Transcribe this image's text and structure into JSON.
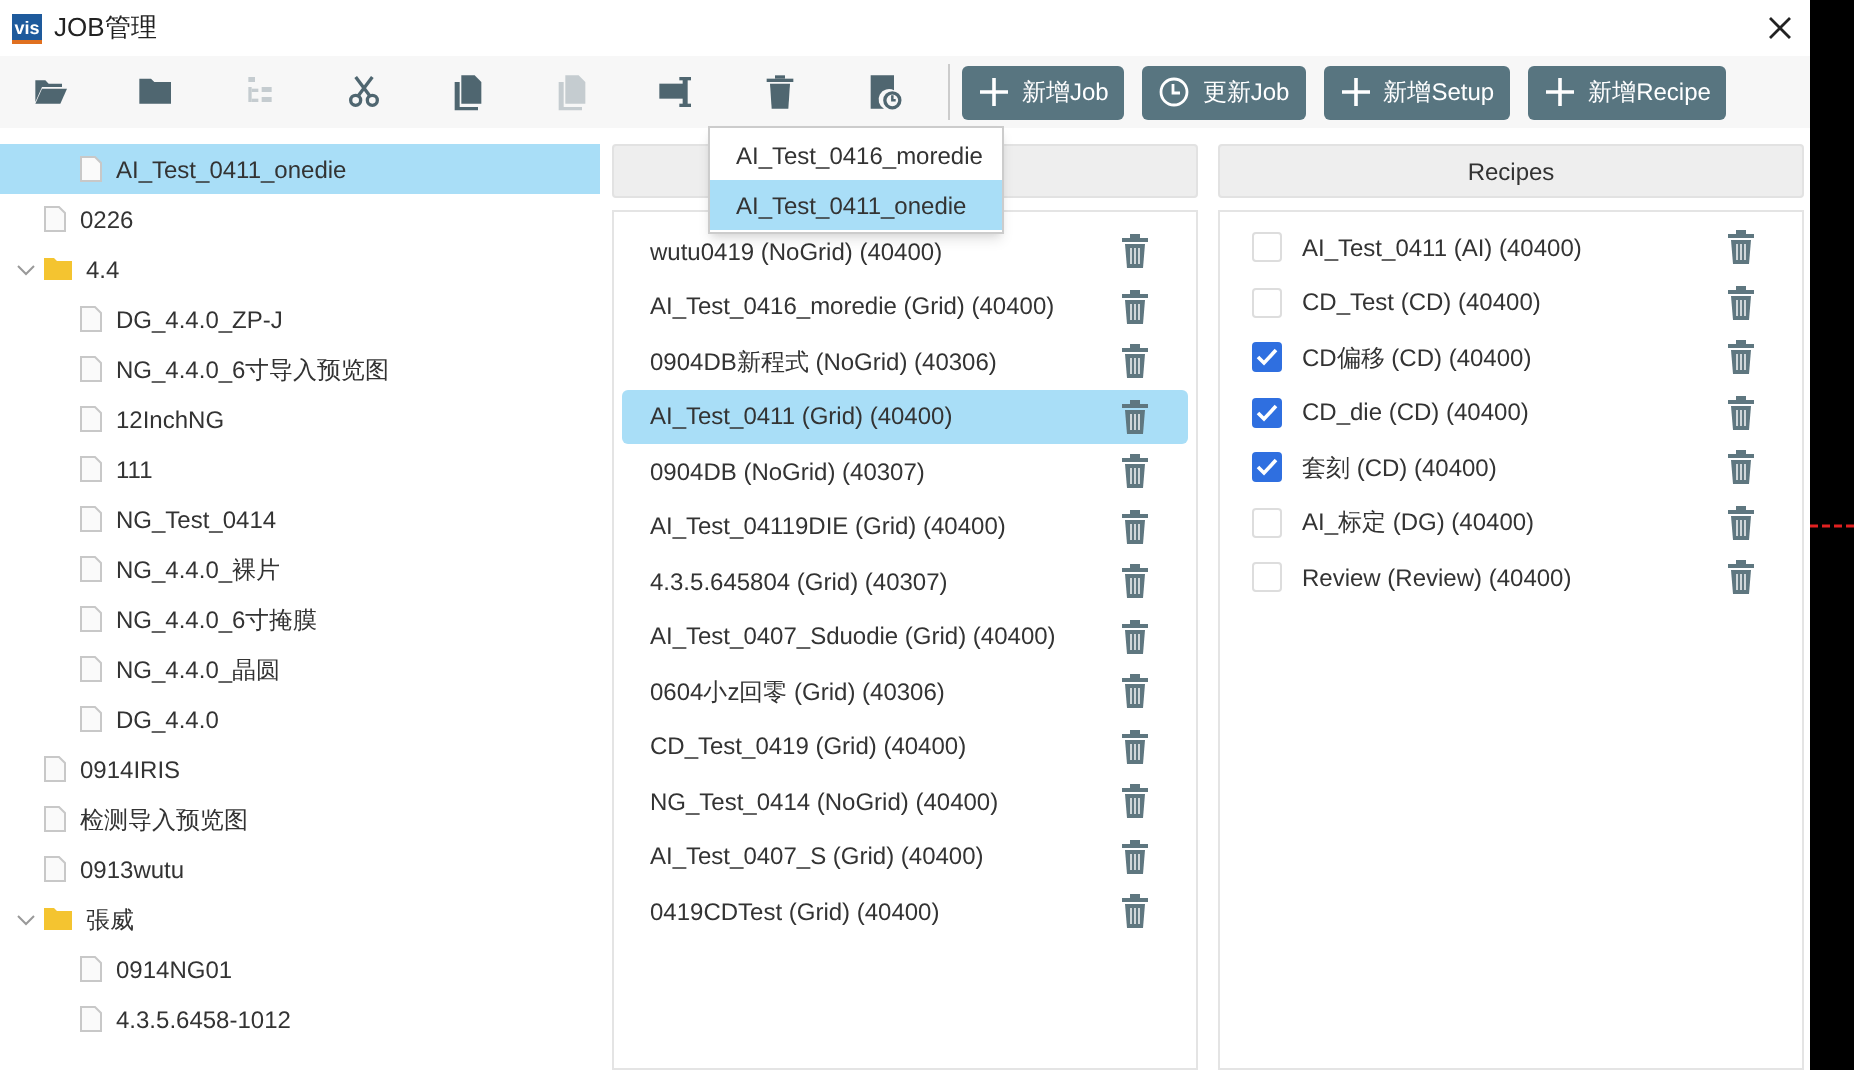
{
  "window": {
    "title": "JOB管理",
    "logo": "vis"
  },
  "toolbar": {
    "icons": [
      {
        "kind": "open-folder",
        "disabled": false
      },
      {
        "kind": "folder",
        "disabled": false
      },
      {
        "kind": "tree",
        "disabled": true
      },
      {
        "kind": "cut",
        "disabled": false
      },
      {
        "kind": "copy",
        "disabled": false
      },
      {
        "kind": "paste",
        "disabled": true
      },
      {
        "kind": "rename",
        "disabled": false
      },
      {
        "kind": "trash",
        "disabled": false
      },
      {
        "kind": "clock-doc",
        "disabled": false
      }
    ],
    "buttons": [
      {
        "kind": "plus",
        "label": "新增Job"
      },
      {
        "kind": "clock",
        "label": "更新Job"
      },
      {
        "kind": "plus",
        "label": "新增Setup"
      },
      {
        "kind": "plus",
        "label": "新增Recipe"
      }
    ]
  },
  "tree": [
    {
      "children": [
        {
          "label": "AI_Test_0411_onedie",
          "kind": "file",
          "selected": true
        }
      ]
    },
    {
      "label": "0226",
      "kind": "file",
      "selected": false
    },
    {
      "label": "4.4",
      "kind": "folder",
      "selected": false,
      "expanded": true,
      "children": [
        {
          "label": "DG_4.4.0_ZP-J",
          "kind": "file",
          "selected": false
        },
        {
          "label": "NG_4.4.0_6寸导入预览图",
          "kind": "file",
          "selected": false
        },
        {
          "label": "12InchNG",
          "kind": "file",
          "selected": false
        },
        {
          "label": "111",
          "kind": "file",
          "selected": false
        },
        {
          "label": "NG_Test_0414",
          "kind": "file",
          "selected": false
        },
        {
          "label": "NG_4.4.0_裸片",
          "kind": "file",
          "selected": false
        },
        {
          "label": "NG_4.4.0_6寸掩膜",
          "kind": "file",
          "selected": false
        },
        {
          "label": "NG_4.4.0_晶圆",
          "kind": "file",
          "selected": false
        },
        {
          "label": "DG_4.4.0",
          "kind": "file",
          "selected": false
        }
      ]
    },
    {
      "label": "0914IRIS",
      "kind": "file",
      "selected": false
    },
    {
      "label": "检测导入预览图",
      "kind": "file",
      "selected": false
    },
    {
      "label": "0913wutu",
      "kind": "file",
      "selected": false
    },
    {
      "label": "張威",
      "kind": "folder",
      "selected": false,
      "expanded": true,
      "children": [
        {
          "label": "0914NG01",
          "kind": "file",
          "selected": false
        },
        {
          "label": "4.3.5.6458-1012",
          "kind": "file",
          "selected": false
        }
      ]
    }
  ],
  "setups": {
    "items": [
      {
        "label": "wutu0419 (NoGrid) (40400)",
        "selected": false
      },
      {
        "label": "AI_Test_0416_moredie (Grid) (40400)",
        "selected": false
      },
      {
        "label": "0904DB新程式 (NoGrid) (40306)",
        "selected": false
      },
      {
        "label": "AI_Test_0411 (Grid) (40400)",
        "selected": true
      },
      {
        "label": "0904DB (NoGrid) (40307)",
        "selected": false
      },
      {
        "label": "AI_Test_04119DIE (Grid) (40400)",
        "selected": false
      },
      {
        "label": "4.3.5.645804 (Grid) (40307)",
        "selected": false
      },
      {
        "label": "AI_Test_0407_Sduodie (Grid) (40400)",
        "selected": false
      },
      {
        "label": "0604小z回零 (Grid) (40306)",
        "selected": false
      },
      {
        "label": "CD_Test_0419 (Grid) (40400)",
        "selected": false
      },
      {
        "label": "NG_Test_0414 (NoGrid) (40400)",
        "selected": false
      },
      {
        "label": "AI_Test_0407_S (Grid) (40400)",
        "selected": false
      },
      {
        "label": "0419CDTest (Grid) (40400)",
        "selected": false
      }
    ]
  },
  "recipes": {
    "header": "Recipes",
    "items": [
      {
        "label": "AI_Test_0411 (AI) (40400)",
        "checked": false
      },
      {
        "label": "CD_Test (CD) (40400)",
        "checked": false
      },
      {
        "label": "CD偏移 (CD) (40400)",
        "checked": true
      },
      {
        "label": "CD_die (CD) (40400)",
        "checked": true
      },
      {
        "label": "套刻 (CD) (40400)",
        "checked": true
      },
      {
        "label": "AI_标定 (DG) (40400)",
        "checked": false
      },
      {
        "label": "Review (Review) (40400)",
        "checked": false
      }
    ]
  },
  "popup": {
    "items": [
      {
        "label": "AI_Test_0416_moredie",
        "selected": false
      },
      {
        "label": "AI_Test_0411_onedie",
        "selected": true
      }
    ]
  }
}
